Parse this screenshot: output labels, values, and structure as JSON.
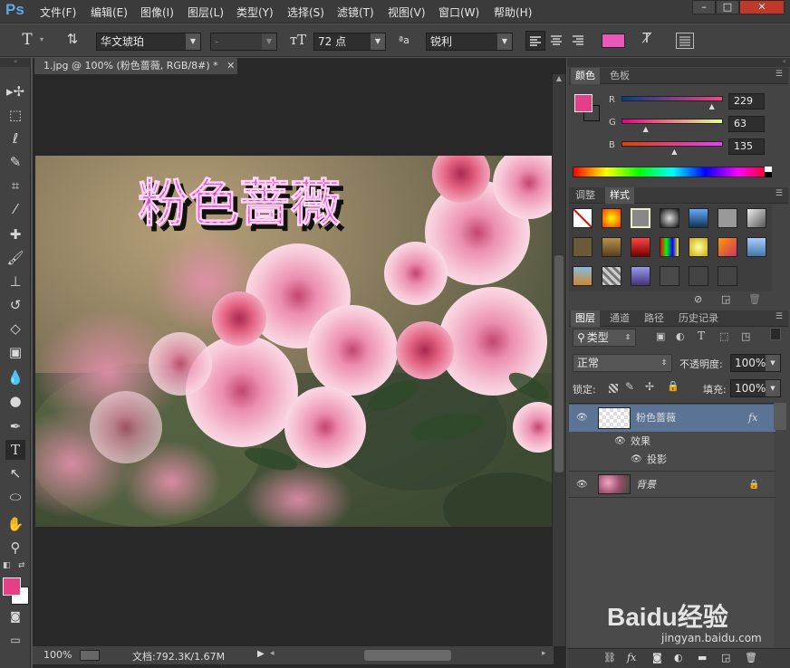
{
  "app": {
    "logo": "Ps"
  },
  "menubar": {
    "items": [
      "文件(F)",
      "编辑(E)",
      "图像(I)",
      "图层(L)",
      "类型(Y)",
      "选择(S)",
      "滤镜(T)",
      "视图(V)",
      "窗口(W)",
      "帮助(H)"
    ],
    "window_buttons": [
      "–",
      "□",
      "✕"
    ]
  },
  "options": {
    "font_family": "华文琥珀",
    "font_style": "-",
    "font_size": "72 点",
    "antialias_label": "ªa",
    "antialias": "锐利",
    "text_color": "#e858b8"
  },
  "document": {
    "tab_title": "1.jpg @ 100% (粉色蔷薇, RGB/8#) *",
    "canvas_text": "粉色蔷薇",
    "zoom": "100%",
    "doc_info": "文档:792.3K/1.67M"
  },
  "panels": {
    "color": {
      "tabs": [
        "颜色",
        "色板"
      ],
      "channels": [
        {
          "label": "R",
          "value": "229",
          "fraction": 0.898
        },
        {
          "label": "G",
          "value": "63",
          "fraction": 0.247
        },
        {
          "label": "B",
          "value": "135",
          "fraction": 0.529
        }
      ],
      "foreground": "#e53f87",
      "background": "#ffffff"
    },
    "styles": {
      "tabs": [
        "调整",
        "样式"
      ]
    },
    "layers": {
      "tabs": [
        "图层",
        "通道",
        "路径",
        "历史记录"
      ],
      "filter_label": "类型",
      "blend_mode": "正常",
      "opacity_label": "不透明度:",
      "opacity": "100%",
      "lock_label": "锁定:",
      "fill_label": "填充:",
      "fill": "100%",
      "layers": [
        {
          "name": "粉色蔷薇",
          "type": "text",
          "fx": "fx"
        },
        {
          "name": "效果",
          "type": "effect-group"
        },
        {
          "name": "投影",
          "type": "effect"
        },
        {
          "name": "背景",
          "type": "background"
        }
      ]
    }
  },
  "watermark": {
    "brand": "Baidu经验",
    "url": "jingyan.baidu.com"
  }
}
